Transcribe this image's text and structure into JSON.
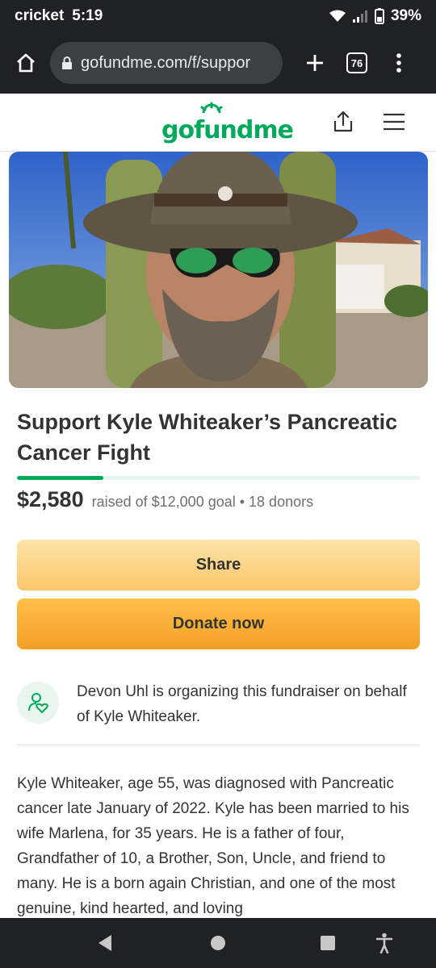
{
  "status_bar": {
    "carrier": "cricket",
    "time": "5:19",
    "battery": "39%"
  },
  "browser": {
    "url": "gofundme.com/f/suppor",
    "tab_count": "76"
  },
  "site": {
    "logo_text": "gofundme"
  },
  "campaign": {
    "title": "Support Kyle Whiteaker’s Pancreatic Cancer Fight",
    "progress_fraction": 0.215,
    "raised": "$2,580",
    "meta": "raised of $12,000 goal • 18 donors",
    "share_label": "Share",
    "donate_label": "Donate now",
    "organizer_text": "Devon Uhl is organizing this fundraiser on behalf of Kyle Whiteaker.",
    "story": "Kyle Whiteaker, age 55, was diagnosed with Pancreatic cancer late January of 2022. Kyle has been married to his wife Marlena, for 35 years. He is a father of four, Grandfather of 10, a Brother, Son, Uncle, and friend to many. He is a born again Christian, and one of the most genuine, kind hearted, and loving"
  },
  "colors": {
    "brand_green": "#02a95c",
    "donate_orange": "#f59f25",
    "share_yellow": "#fcc76a"
  }
}
